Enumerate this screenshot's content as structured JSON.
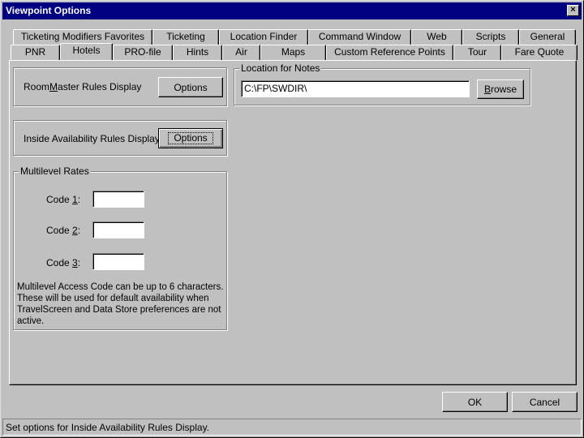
{
  "window": {
    "title": "Viewpoint Options",
    "close_label": "×"
  },
  "tabs_back": [
    {
      "label": "Ticketing Modifiers Favorites"
    },
    {
      "label": "Ticketing"
    },
    {
      "label": "Location Finder"
    },
    {
      "label": "Command Window"
    },
    {
      "label": "Web"
    },
    {
      "label": "Scripts"
    },
    {
      "label": "General"
    }
  ],
  "tabs_front": [
    {
      "label": "PNR"
    },
    {
      "label": "Hotels",
      "active": true
    },
    {
      "label": "PRO-file"
    },
    {
      "label": "Hints"
    },
    {
      "label": "Air"
    },
    {
      "label": "Maps"
    },
    {
      "label": "Custom Reference Points"
    },
    {
      "label": "Tour"
    },
    {
      "label": "Fare Quote"
    }
  ],
  "roommaster": {
    "label_pre": "Room",
    "label_ul": "M",
    "label_post": "aster Rules Display",
    "button": "Options"
  },
  "inside": {
    "label": "Inside Availability Rules Display",
    "button": "Options"
  },
  "location_notes": {
    "group_label": "Location for Notes",
    "path_value": "C:\\FP\\SWDIR\\",
    "browse_ul": "B",
    "browse_post": "rowse"
  },
  "multilevel": {
    "group_label": "Multilevel Rates",
    "codes": [
      {
        "pre": "Code ",
        "ul": "1",
        "post": ":",
        "value": ""
      },
      {
        "pre": "Code ",
        "ul": "2",
        "post": ":",
        "value": ""
      },
      {
        "pre": "Code ",
        "ul": "3",
        "post": ":",
        "value": ""
      }
    ],
    "note_lines": [
      "Multilevel Access Code can be up to 6 characters.",
      "These will be used for default availability when",
      "TravelScreen and Data Store preferences are not",
      "active."
    ]
  },
  "buttons": {
    "ok": "OK",
    "cancel": "Cancel"
  },
  "status": "Set options for Inside Availability Rules Display."
}
